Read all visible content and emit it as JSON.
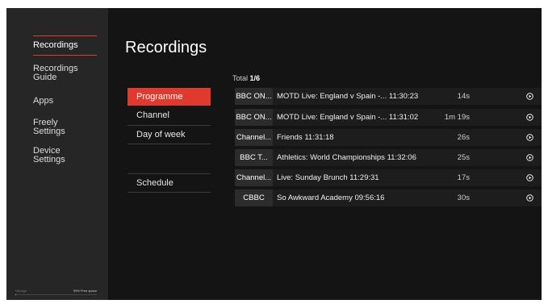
{
  "sidebar": {
    "items": [
      {
        "label": "Recordings"
      },
      {
        "label": "Recordings Guide"
      },
      {
        "label": "Apps"
      },
      {
        "label": "Freely Settings"
      },
      {
        "label": "Device Settings"
      }
    ],
    "storage": {
      "label": "Storage",
      "free": "99% Free space",
      "used_fraction": 0.01
    }
  },
  "main": {
    "title": "Recordings",
    "filters": [
      {
        "label": "Programme"
      },
      {
        "label": "Channel"
      },
      {
        "label": "Day of week"
      },
      {
        "label": "Schedule"
      }
    ],
    "total": {
      "prefix": "Total",
      "value": "1/6"
    },
    "rows": [
      {
        "channel": "BBC ON...",
        "title": "MOTD Live: England v Spain -... 11:30:23",
        "duration": "14s"
      },
      {
        "channel": "BBC ON...",
        "title": "MOTD Live: England v Spain -... 11:31:02",
        "duration": "1m 19s"
      },
      {
        "channel": "Channel...",
        "title": "Friends 11:31:18",
        "duration": "26s"
      },
      {
        "channel": "BBC T...",
        "title": "Athletics: World Championships 11:32:06",
        "duration": "25s"
      },
      {
        "channel": "Channel...",
        "title": "Live: Sunday Brunch 11:29:31",
        "duration": "17s"
      },
      {
        "channel": "CBBC",
        "title": "So Awkward Academy 09:56:16",
        "duration": "30s"
      }
    ]
  },
  "colors": {
    "accent": "#e03a2f",
    "background": "#141414",
    "sidebar": "#262626"
  },
  "icons": {
    "row_action": "play-circle-icon"
  }
}
